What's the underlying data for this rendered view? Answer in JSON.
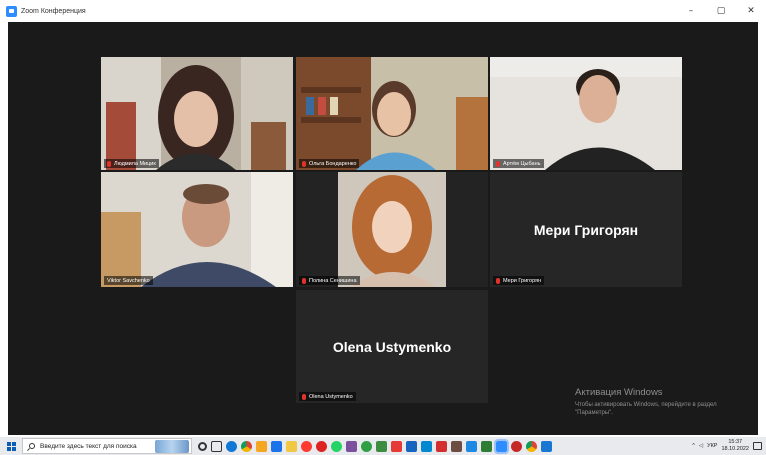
{
  "window": {
    "title": "Zoom Конференция",
    "minimize": "–",
    "restore": "▢",
    "close": "✕"
  },
  "participants": [
    {
      "name": "Людмила Мицик",
      "video": true
    },
    {
      "name": "Ольга Бондаренко",
      "video": true
    },
    {
      "name": "Артём Цыбань",
      "video": true
    },
    {
      "name": "Viktor Savchenko",
      "video": true,
      "active_speaker": true
    },
    {
      "name": "Полина Сенишина",
      "video": true
    },
    {
      "name": "Мери Григорян",
      "video": false,
      "display_name": "Мери Григорян"
    },
    {
      "name": "Olena Ustymenko",
      "video": false,
      "display_name": "Olena Ustymenko"
    }
  ],
  "activation": {
    "title": "Активация Windows",
    "subtitle": "Чтобы активировать Windows, перейдите в раздел \"Параметры\"."
  },
  "taskbar": {
    "search_placeholder": "Введите здесь текст для поиска",
    "language": "УКР",
    "time": "15:37",
    "date": "18.10.2022"
  },
  "colors": {
    "stage": "#1a1a1a",
    "tile": "#262626",
    "active_border": "#a7d23a",
    "mic_muted": "#e0342b"
  }
}
